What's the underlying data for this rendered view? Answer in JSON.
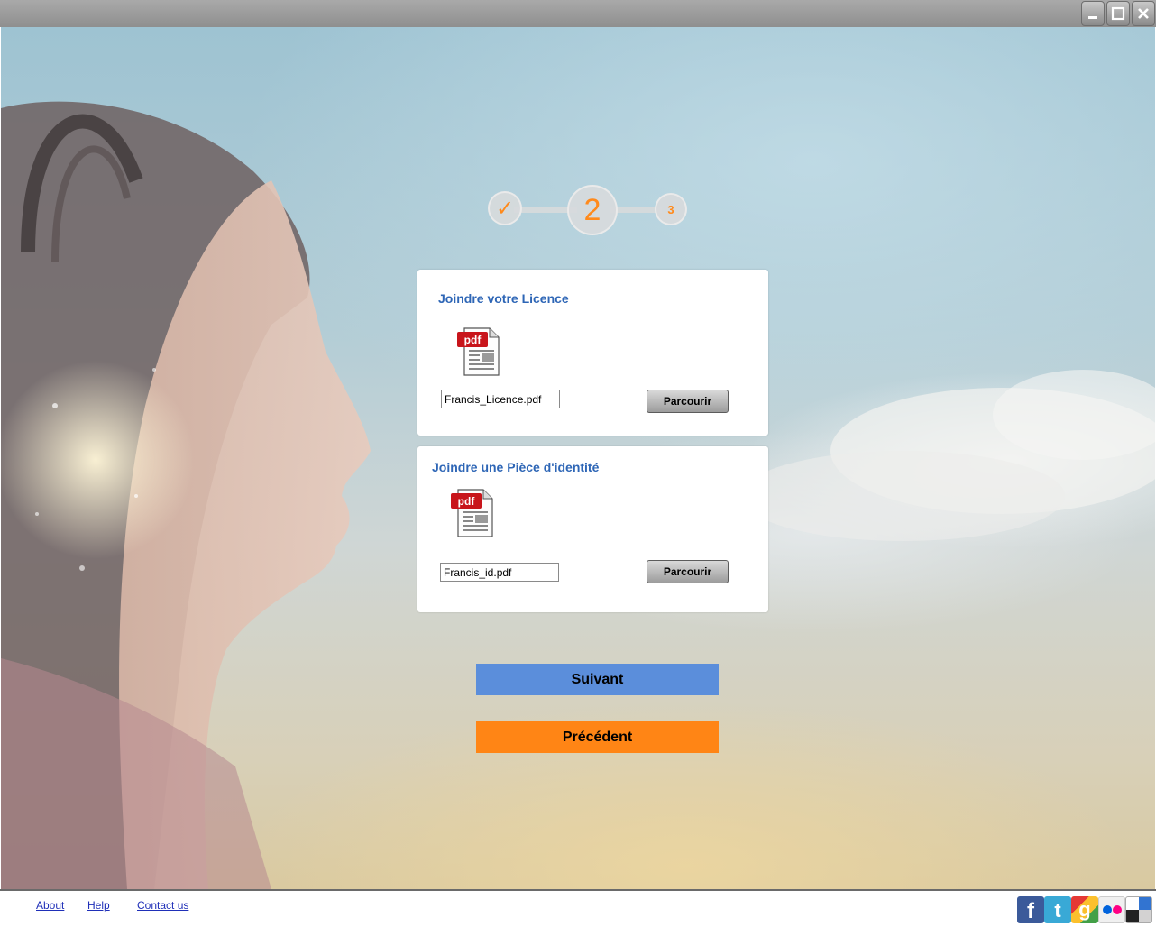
{
  "window": {
    "controls": [
      "minimize-icon",
      "maximize-icon",
      "close-icon"
    ]
  },
  "stepper": {
    "steps": [
      {
        "state": "done",
        "label": "✓"
      },
      {
        "state": "current",
        "label": "2"
      },
      {
        "state": "upcoming",
        "label": "3"
      }
    ],
    "accent_color": "#ff8a1c"
  },
  "license_card": {
    "title": "Joindre votre Licence",
    "icon": "pdf-icon",
    "file_value": "Francis_Licence.pdf",
    "browse_label": "Parcourir"
  },
  "id_card": {
    "title": "Joindre une Pièce d'identité",
    "icon": "pdf-icon",
    "file_value": "Francis_id.pdf",
    "browse_label": "Parcourir"
  },
  "actions": {
    "next_label": "Suivant",
    "next_color": "#5b8edb",
    "prev_label": "Précédent",
    "prev_color": "#ff8515"
  },
  "footer": {
    "links": [
      "About",
      "Help",
      "Contact us"
    ],
    "social": [
      "facebook-icon",
      "twitter-icon",
      "google-icon",
      "flickr-icon",
      "delicious-icon"
    ]
  }
}
